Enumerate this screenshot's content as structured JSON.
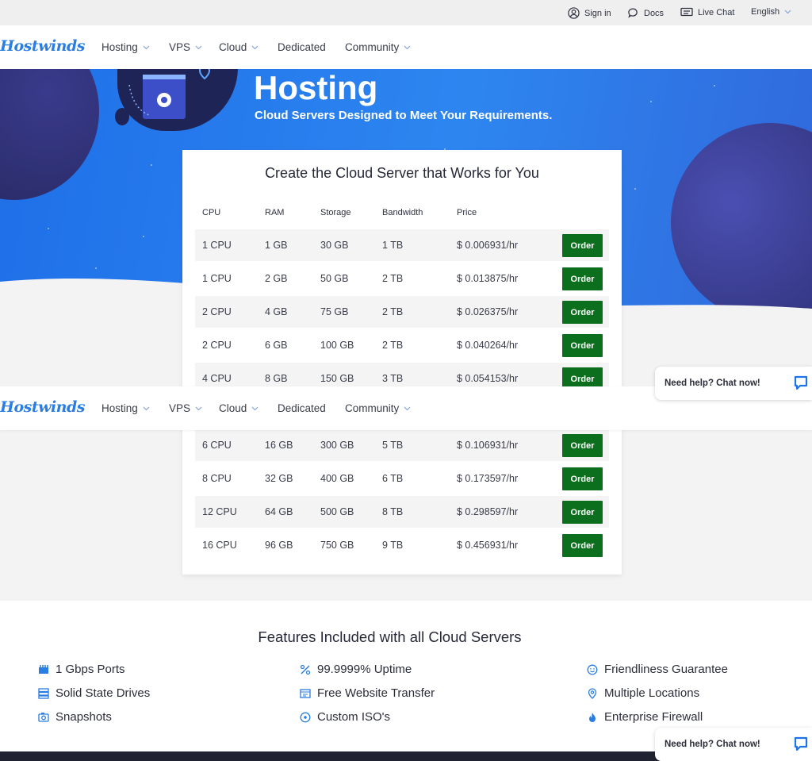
{
  "topbar": {
    "sign_in": "Sign in",
    "docs": "Docs",
    "live_chat": "Live Chat",
    "language": "English"
  },
  "nav": {
    "logo": "Hostwinds",
    "items": [
      "Hosting",
      "VPS",
      "Cloud",
      "Dedicated",
      "Community"
    ]
  },
  "hero": {
    "title": "Hosting",
    "subtitle": "Cloud Servers Designed to Meet Your Requirements."
  },
  "pricing": {
    "title": "Create the Cloud Server that Works for You",
    "headers": [
      "CPU",
      "RAM",
      "Storage",
      "Bandwidth",
      "Price"
    ],
    "order_label": "Order",
    "rows_top": [
      [
        "1 CPU",
        "1 GB",
        "30 GB",
        "1 TB",
        "$ 0.006931/hr"
      ],
      [
        "1 CPU",
        "2 GB",
        "50 GB",
        "2 TB",
        "$ 0.013875/hr"
      ],
      [
        "2 CPU",
        "4 GB",
        "75 GB",
        "2 TB",
        "$ 0.026375/hr"
      ],
      [
        "2 CPU",
        "6 GB",
        "100 GB",
        "2 TB",
        "$ 0.040264/hr"
      ],
      [
        "4 CPU",
        "8 GB",
        "150 GB",
        "3 TB",
        "$ 0.054153/hr"
      ]
    ],
    "rows_bottom": [
      [
        "6 CPU",
        "16 GB",
        "300 GB",
        "5 TB",
        "$ 0.106931/hr"
      ],
      [
        "8 CPU",
        "32 GB",
        "400 GB",
        "6 TB",
        "$ 0.173597/hr"
      ],
      [
        "12 CPU",
        "64 GB",
        "500 GB",
        "8 TB",
        "$ 0.298597/hr"
      ],
      [
        "16 CPU",
        "96 GB",
        "750 GB",
        "9 TB",
        "$ 0.456931/hr"
      ]
    ]
  },
  "features": {
    "title": "Features Included with all Cloud Servers",
    "col1": [
      "1 Gbps Ports",
      "Solid State Drives",
      "Snapshots"
    ],
    "col2": [
      "99.9999% Uptime",
      "Free Website Transfer",
      "Custom ISO's"
    ],
    "col3": [
      "Friendliness Guarantee",
      "Multiple Locations",
      "Enterprise Firewall"
    ]
  },
  "chat": {
    "label": "Need help? Chat now!"
  },
  "colors": {
    "brand_blue": "#2a7de1",
    "order_green": "#0b6f1d"
  }
}
